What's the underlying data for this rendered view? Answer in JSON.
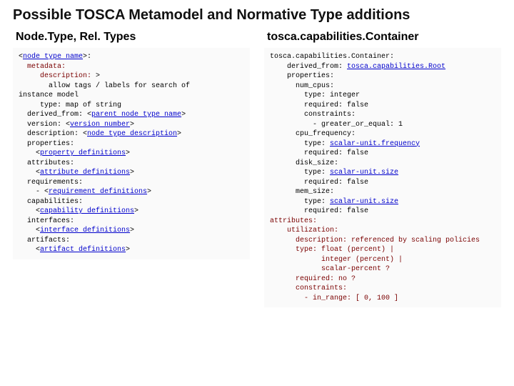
{
  "title": "Possible TOSCA Metamodel and Normative Type additions",
  "left": {
    "heading": "Node.Type, Rel. Types",
    "code_html": "&lt;<span class=\"ph\">node type name</span>&gt;:\n  <span class=\"kw\">metadata:</span>\n     <span class=\"kw\">description:</span> &gt;\n       allow tags / labels for search of\ninstance model\n     type: map of string\n  derived_from: &lt;<span class=\"ph\">parent node type name</span>&gt;\n  version: &lt;<span class=\"ph\">version number</span>&gt;\n  description: &lt;<span class=\"ph\">node type description</span>&gt;\n  properties:\n    &lt;<span class=\"ph\">property definitions</span>&gt;\n  attributes:\n    &lt;<span class=\"ph\">attribute definitions</span>&gt;\n  requirements:\n    - &lt;<span class=\"ph\">requirement definitions</span>&gt;\n  capabilities:\n    &lt;<span class=\"ph\">capability definitions</span>&gt;\n  interfaces:\n    &lt;<span class=\"ph\">interface definitions</span>&gt;\n  artifacts:\n    &lt;<span class=\"ph\">artifact definitions</span>&gt;"
  },
  "right": {
    "heading": "tosca.capabilities.Container",
    "code_html": "tosca.capabilities.Container:\n    derived_from: <span class=\"ph\">tosca.capabilities.Root</span>\n    properties:\n      num_cpus:\n        type: integer\n        required: false\n        constraints:\n          - greater_or_equal: 1\n      cpu_frequency:\n        type: <span class=\"ph\">scalar-unit.frequency</span>\n        required: false\n      disk_size:\n        type: <span class=\"ph\">scalar-unit.size</span>\n        required: false\n      mem_size:\n        type: <span class=\"ph\">scalar-unit.size</span>\n        required: false\n<span class=\"kw\">attributes:</span>\n    <span class=\"kw\">utilization:</span>\n      <span class=\"kw\">description: referenced by scaling policies</span>\n      <span class=\"kw\">type: float (percent) |</span>\n            <span class=\"kw\">integer (percent) |</span>\n            <span class=\"kw\">scalar-percent ?</span>\n      <span class=\"kw\">required: no ?</span>\n      <span class=\"kw\">constraints:</span>\n        <span class=\"kw\">- in_range: [ 0, 100 ]</span>"
  }
}
